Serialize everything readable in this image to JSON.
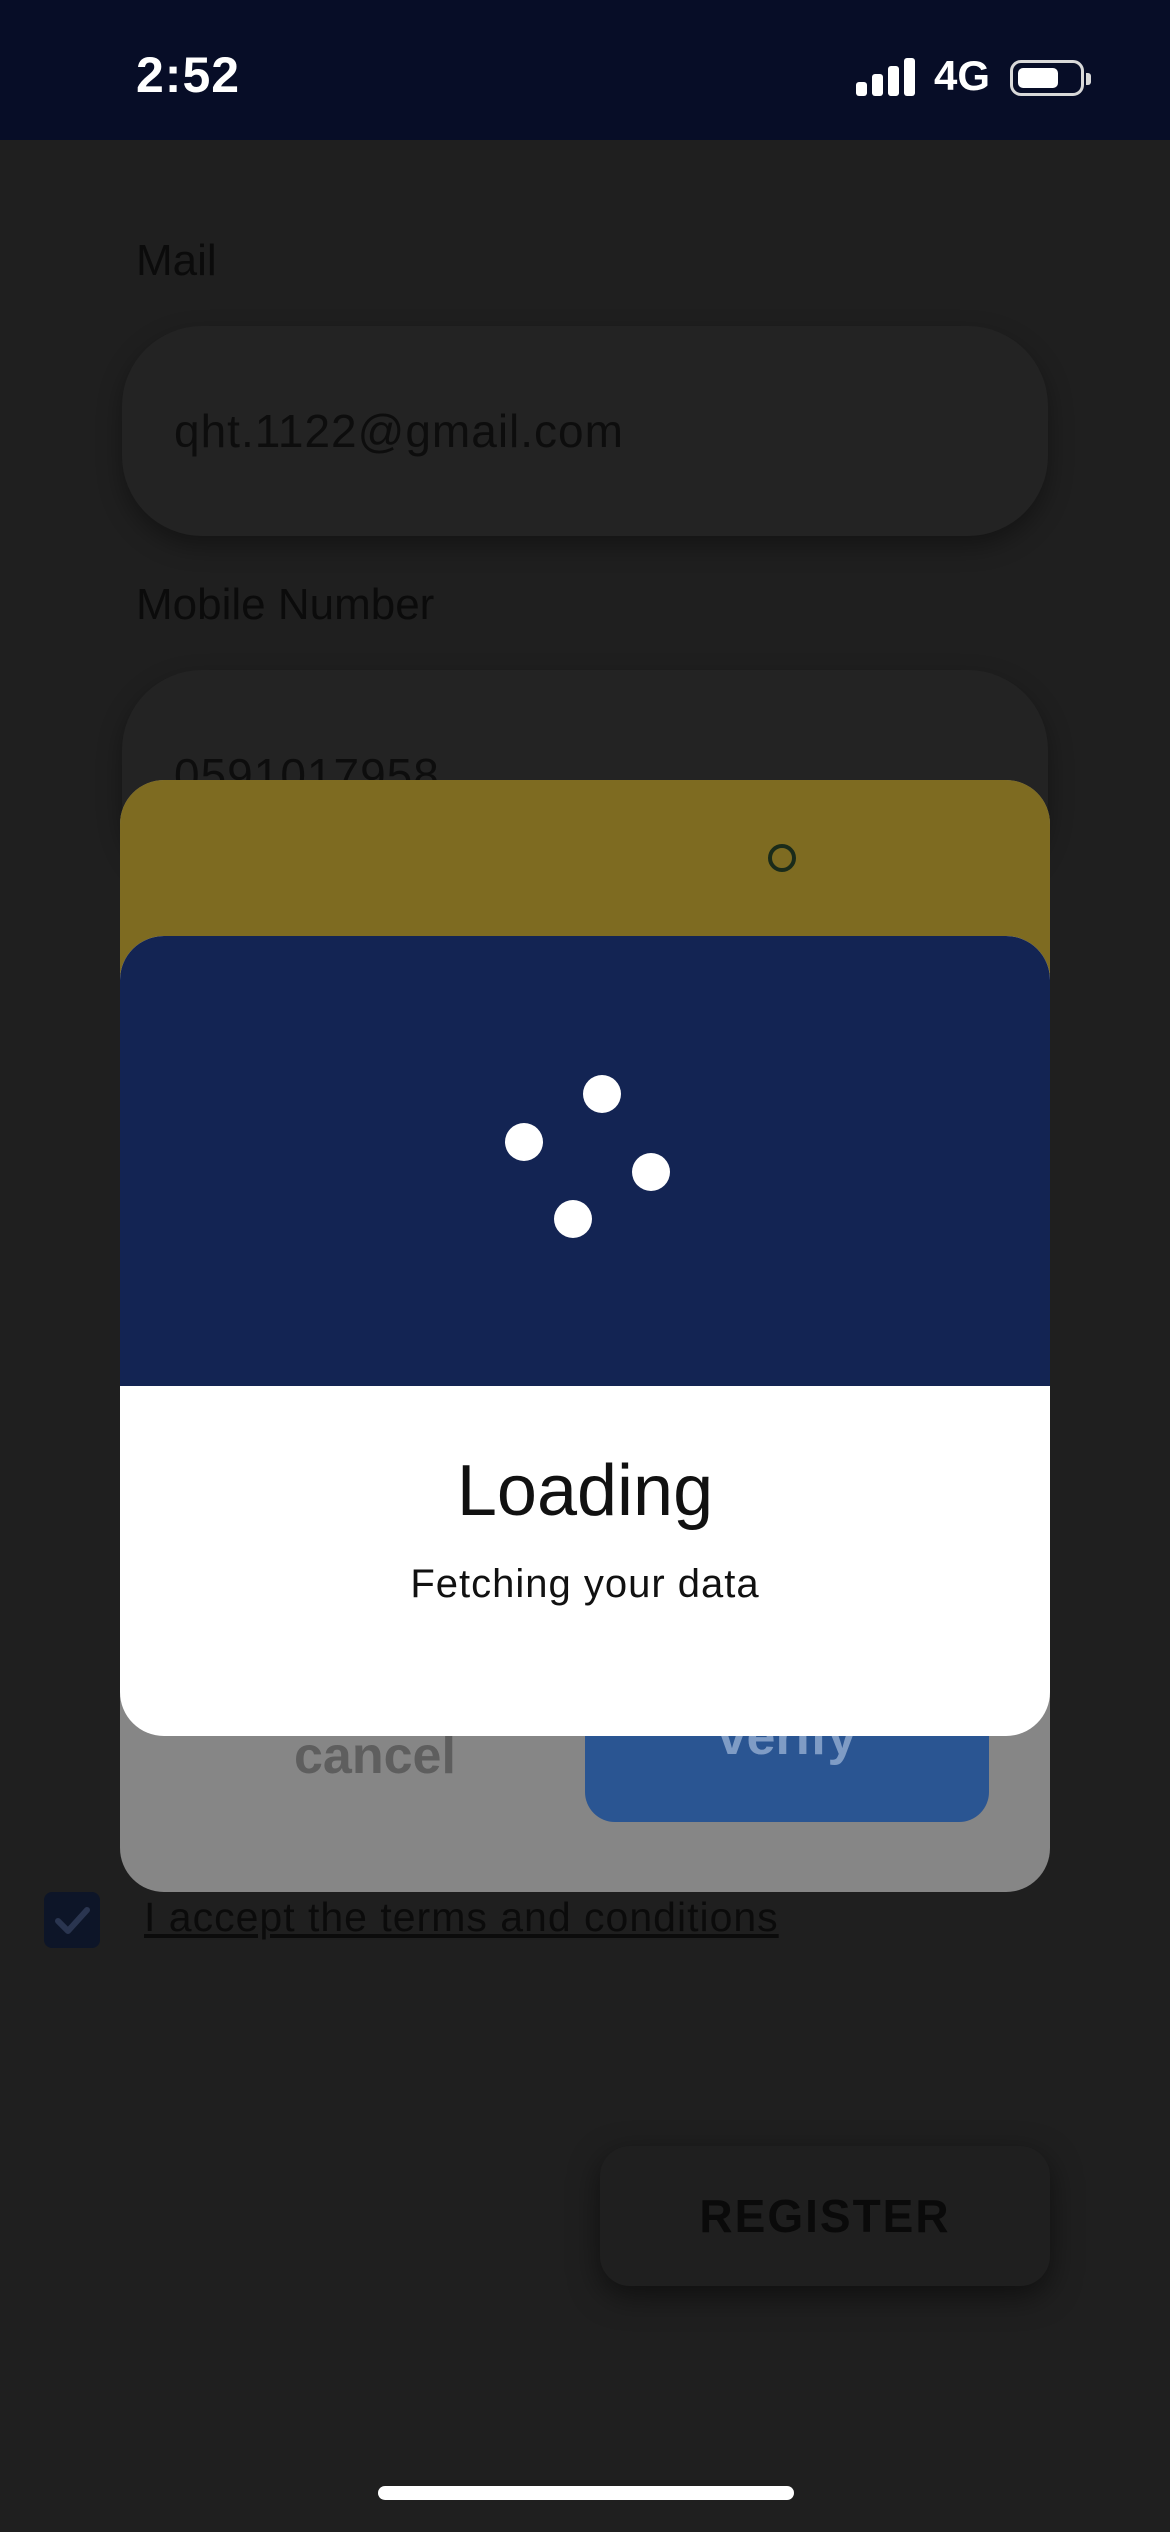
{
  "status_bar": {
    "time": "2:52",
    "network": "4G"
  },
  "form": {
    "mail_label": "Mail",
    "mail_value": "qht.1122@gmail.com",
    "mobile_label": "Mobile Number",
    "mobile_value": "0591017958",
    "terms_text": "I accept the terms and conditions",
    "terms_checked": true,
    "register_label": "REGISTER"
  },
  "verify_dialog": {
    "cancel_label": "cancel",
    "verify_label": "verify"
  },
  "loading_dialog": {
    "title": "Loading",
    "subtitle": "Fetching your data"
  },
  "colors": {
    "status_bar_bg": "#070d27",
    "loading_header": "#132453",
    "dialog_yellow": "#7e6b21",
    "verify_button": "#2a5592"
  }
}
